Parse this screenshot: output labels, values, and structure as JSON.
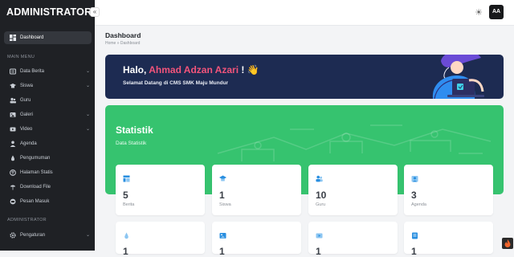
{
  "app": {
    "brand": "ADMINISTRATOR",
    "avatar_initials": "AA"
  },
  "sidebar": {
    "items": [
      {
        "label": "Dashboard",
        "icon": "dashboard-icon",
        "has_children": false
      },
      {
        "label": "Data Berita",
        "icon": "news-icon",
        "has_children": true
      },
      {
        "label": "Siswa",
        "icon": "students-icon",
        "has_children": true
      },
      {
        "label": "Guru",
        "icon": "teachers-icon",
        "has_children": false
      },
      {
        "label": "Galeri",
        "icon": "gallery-icon",
        "has_children": true
      },
      {
        "label": "Video",
        "icon": "video-icon",
        "has_children": true
      },
      {
        "label": "Agenda",
        "icon": "agenda-icon",
        "has_children": false
      },
      {
        "label": "Pengumuman",
        "icon": "announcement-icon",
        "has_children": false
      },
      {
        "label": "Halaman Statis",
        "icon": "page-icon",
        "has_children": false
      },
      {
        "label": "Download File",
        "icon": "download-icon",
        "has_children": false
      },
      {
        "label": "Pesan Masuk",
        "icon": "inbox-icon",
        "has_children": false
      },
      {
        "label": "Pengaturan",
        "icon": "settings-icon",
        "has_children": true
      }
    ],
    "section_main": "MAIN MENU",
    "section_admin": "ADMINISTRATOR"
  },
  "header": {
    "title": "Dashboard",
    "breadcrumb_home": "Home",
    "breadcrumb_sep": "»",
    "breadcrumb_current": "Dashboard"
  },
  "hero": {
    "greeting_prefix": "Halo,",
    "user_name": "Ahmad Adzan Azari",
    "greeting_suffix": "!",
    "wave": "👋",
    "subtitle": "Selamat Datang di CMS SMK Maju Mundur"
  },
  "stats": {
    "title": "Statistik",
    "subtitle": "Data Statistik",
    "cards": [
      {
        "value": "5",
        "label": "Berita",
        "icon": "news-icon"
      },
      {
        "value": "1",
        "label": "Siswa",
        "icon": "students-icon"
      },
      {
        "value": "10",
        "label": "Guru",
        "icon": "teachers-icon"
      },
      {
        "value": "3",
        "label": "Agenda",
        "icon": "agenda-icon"
      }
    ],
    "cards_row2": [
      {
        "value": "1",
        "icon": "announcement-icon"
      },
      {
        "value": "1",
        "icon": "gallery-icon"
      },
      {
        "value": "1",
        "icon": "video-icon"
      },
      {
        "value": "1",
        "icon": "page-icon"
      }
    ]
  },
  "colors": {
    "sidebar_bg": "#1f2125",
    "hero_bg": "#1d2b52",
    "accent_pink": "#f2547b",
    "stats_green": "#36c36f",
    "card_icon_blue": "#2a8fe0"
  }
}
